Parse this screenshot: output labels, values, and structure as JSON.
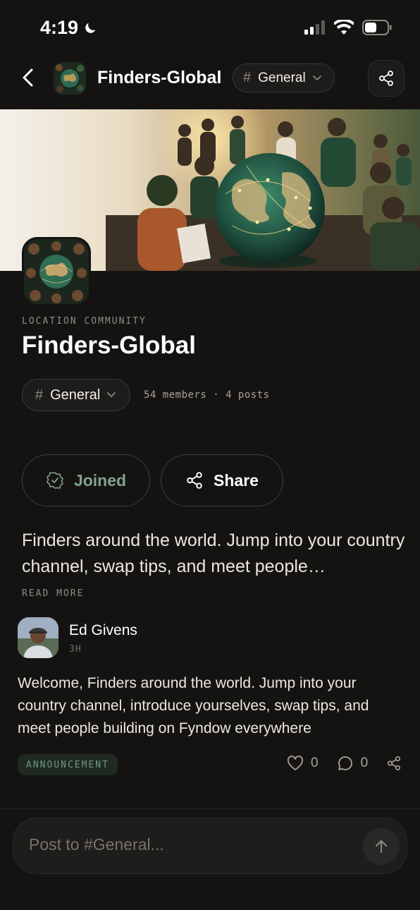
{
  "status": {
    "time": "4:19"
  },
  "nav": {
    "title": "Finders-Global",
    "channel": "General"
  },
  "community": {
    "eyebrow": "LOCATION COMMUNITY",
    "title": "Finders-Global",
    "channel": "General",
    "meta": "54 members · 4 posts",
    "description": "Finders around the world. Jump into your country channel, swap tips, and meet people…",
    "read_more": "READ MORE"
  },
  "buttons": {
    "joined": "Joined",
    "share": "Share"
  },
  "post": {
    "author": "Ed Givens",
    "time": "3H",
    "body": "Welcome, Finders around the world. Jump into your country channel, introduce yourselves, swap tips, and meet people building on Fyndow everywhere",
    "tag": "ANNOUNCEMENT",
    "likes": "0",
    "comments": "0"
  },
  "composer": {
    "placeholder": "Post to #General..."
  },
  "colors": {
    "background": "#151312",
    "accent": "#7fa58c",
    "muted": "#8e8b85"
  },
  "icons": [
    "moon-icon",
    "signal-icon",
    "wifi-icon",
    "battery-icon",
    "back-chevron-icon",
    "share-icon",
    "hash-icon",
    "chevron-down-icon",
    "shield-check-icon",
    "heart-icon",
    "comment-icon",
    "arrow-up-icon"
  ]
}
